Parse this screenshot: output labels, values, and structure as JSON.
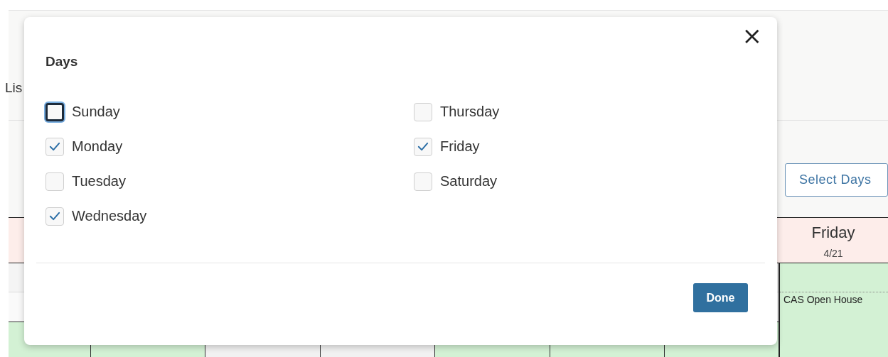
{
  "page": {
    "heading_fragment": "Lis",
    "select_days_button": "Select Days"
  },
  "calendar": {
    "visible_column": {
      "day": "Friday",
      "date": "4/21",
      "events": [
        {
          "title": "CAS Open House"
        }
      ]
    }
  },
  "dialog": {
    "title": "Days",
    "close": "×",
    "days": [
      {
        "label": "Sunday",
        "checked": false,
        "focused": true
      },
      {
        "label": "Monday",
        "checked": true,
        "focused": false
      },
      {
        "label": "Tuesday",
        "checked": false,
        "focused": false
      },
      {
        "label": "Wednesday",
        "checked": true,
        "focused": false
      },
      {
        "label": "Thursday",
        "checked": false,
        "focused": false
      },
      {
        "label": "Friday",
        "checked": true,
        "focused": false
      },
      {
        "label": "Saturday",
        "checked": false,
        "focused": false
      }
    ],
    "done_button": "Done"
  }
}
